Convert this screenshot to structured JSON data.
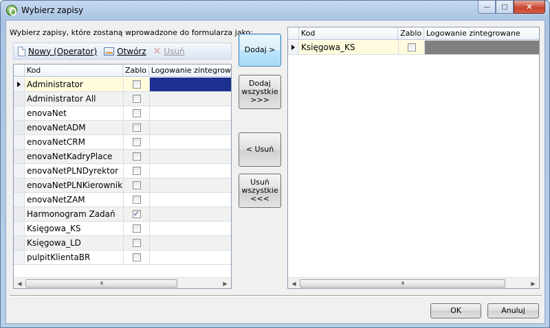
{
  "window": {
    "title": "Wybierz zapisy",
    "controls": {
      "minimize": "—",
      "maximize": "▢",
      "close": "✕"
    }
  },
  "instruction": "Wybierz zapisy, które zostaną wprowadzone do formularza jako:",
  "toolbar": {
    "new_label": "Nowy (Operator)",
    "open_label": "Otwórz",
    "delete_label": "Usuń"
  },
  "left_grid": {
    "columns": [
      "Kod",
      "Zablo",
      "Logowanie zintegrowane"
    ],
    "rows": [
      {
        "kod": "Administrator",
        "zablokowany": false,
        "selected": true
      },
      {
        "kod": "Administrator All",
        "zablokowany": false
      },
      {
        "kod": "enovaNet",
        "zablokowany": false
      },
      {
        "kod": "enovaNetADM",
        "zablokowany": false
      },
      {
        "kod": "enovaNetCRM",
        "zablokowany": false
      },
      {
        "kod": "enovaNetKadryPlace",
        "zablokowany": false
      },
      {
        "kod": "enovaNetPLNDyrektor",
        "zablokowany": false
      },
      {
        "kod": "enovaNetPLNKierownik",
        "zablokowany": false
      },
      {
        "kod": "enovaNetZAM",
        "zablokowany": false
      },
      {
        "kod": "Harmonogram Zadań",
        "zablokowany": true
      },
      {
        "kod": "Księgowa_KS",
        "zablokowany": false
      },
      {
        "kod": "Księgowa_LD",
        "zablokowany": false
      },
      {
        "kod": "pulpitKlientaBR",
        "zablokowany": false
      }
    ],
    "scroll_thumb": "III"
  },
  "right_grid": {
    "columns": [
      "Kod",
      "Zablo",
      "Logowanie zintegrowane"
    ],
    "rows": [
      {
        "kod": "Księgowa_KS",
        "zablokowany": false,
        "selected": true
      }
    ],
    "scroll_thumb": "III"
  },
  "transfer_buttons": {
    "add": "Dodaj >",
    "add_all_line1": "Dodaj",
    "add_all_line2": "wszystkie",
    "add_all_line3": ">>>",
    "remove": "< Usuń",
    "remove_all_line1": "Usuń",
    "remove_all_line2": "wszystkie",
    "remove_all_line3": "<<<"
  },
  "footer": {
    "ok": "OK",
    "cancel": "Anuluj"
  },
  "colors": {
    "selection": "#1d2f8f",
    "selection_inactive": "#808080",
    "current_cell": "#fffbdc"
  }
}
